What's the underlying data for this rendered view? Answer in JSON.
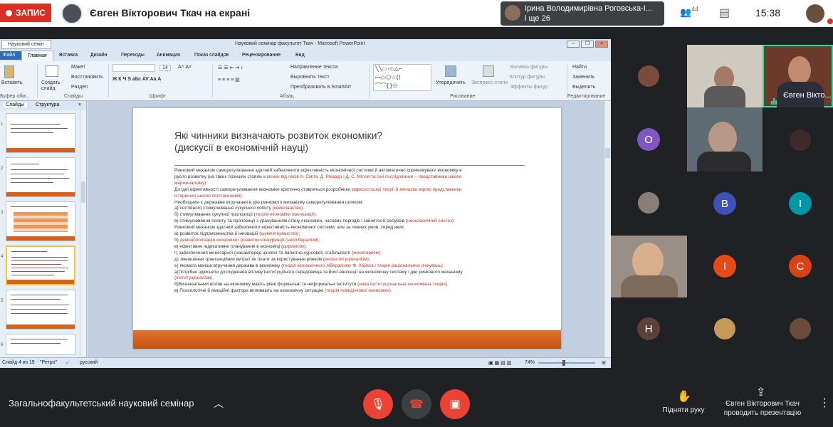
{
  "topbar": {
    "record_label": "ЗАПИС",
    "presenter_banner": "Євген Вікторович Ткач на екрані",
    "active_speaker_line1": "Ірина Володимирівна Роговська-І...",
    "active_speaker_line2": "і ще 26",
    "people_count": "44",
    "time": "15:38"
  },
  "ppt": {
    "tab_label": "Науковий семін",
    "window_title": "Науковий семінар факультет Ткач - Microsoft PowerPoint",
    "ribbon_tabs": [
      "Файл",
      "Главная",
      "Вставка",
      "Дизайн",
      "Переходы",
      "Анимация",
      "Показ слайдов",
      "Рецензирование",
      "Вид"
    ],
    "groups": {
      "clipboard": "Буфер обм...",
      "slides": "Слайды",
      "font": "Шрифт",
      "paragraph": "Абзац",
      "drawing": "Рисование",
      "editing": "Редактирование"
    },
    "ribbon": {
      "paste": "Вставить",
      "new_slide": "Создать слайд",
      "layout": "Макет",
      "reset": "Восстановить",
      "section": "Раздел",
      "font_size": "14",
      "text_direction": "Направление текста",
      "align_text": "Выровнять текст",
      "smartart": "Преобразовать в SmartArt",
      "arrange": "Упорядочить",
      "quick_styles": "Экспресс-стили",
      "shape_fill": "Заливка фигуры",
      "shape_outline": "Контур фигуры",
      "shape_effects": "Эффекты фигур",
      "find": "Найти",
      "replace": "Заменить",
      "select": "Выделить"
    },
    "panel_tabs": [
      "Слайды",
      "Структура"
    ],
    "thumb_numbers": [
      "1",
      "2",
      "3",
      "4",
      "5",
      "6"
    ],
    "slide": {
      "title_line1": "Які чинники визначають розвиток економіки?",
      "title_line2": "(дискусії в економічній науці)",
      "lines": [
        {
          "t": "Ринковий механізм саморегулювання здатний забезпечити ефективність економічної системи й автоматично спрямовувати економіку в",
          "r": ""
        },
        {
          "t": "русло розвитку (на таких позиціях стояли ",
          "r": "класики від часів А. Сміта, Д. Рікардо і Д. С. Мілля та їхні послідовники – представники школи"
        },
        {
          "t": "",
          "r": "маржиналізму)."
        },
        {
          "t": "До ідеї ефективності саморегулювання економіки критично ставляться розробники ",
          "r": "марксистської теорії й меншою мірою представники"
        },
        {
          "t": "",
          "r": "історичної школи політекономії)."
        },
        {
          "t": "Необхідним є державне втручання в дію ринкового механізму саморегулювання шляхом:",
          "r": ""
        },
        {
          "t": "а) постійного стимулювання сукупного попиту (",
          "r": "кейнсіанство);"
        },
        {
          "t": "б) стимулювання сукупної пропозиції (",
          "r": "теорія економіки пропозиції);"
        },
        {
          "t": "в) стимулювання попиту та пропозиції з урахуванням стану економіки, часових періодів і зайнятості ресурсів (",
          "r": "неокласичний синтез)."
        },
        {
          "t": " ",
          "r": ""
        },
        {
          "t": "Ринковий механізм здатний забезпечити ефективність економічної системи, але за певних умов, серед яких:",
          "r": ""
        },
        {
          "t": "а) розвиток підприємництва й інновацій (",
          "r": "шумпетеріанство);"
        },
        {
          "t": "б) ",
          "r": "демонополізація економіки і розвиток конкуренції (неолібералізм);"
        },
        {
          "t": "в) ефективне індикативне планування в економіці (",
          "r": "дирижизм);"
        },
        {
          "t": "г) забезпечення монетарної (насамперед цінової та валютно-курсової) стабільності (",
          "r": "монетаризм);"
        },
        {
          "t": "д) зменшення трансакційних витрат як плати за користування ринком (",
          "r": "неоінституціоналізм);"
        },
        {
          "t": "е) якомога менше втручання держави в економіку (",
          "r": "теорія економічного лібералізму Ф. Хайєка і теорія раціональних очікувань)."
        },
        {
          "t": " ",
          "r": ""
        },
        {
          "t": "а)Потрібно здійснити дослідження впливу інституційного середовища та його еволюції на економічну систему і дію ринкового механізму",
          "r": ""
        },
        {
          "t": "(",
          "r": "інституціоналізм)."
        },
        {
          "t": "б)Визначальний вплив на економіку мають рівні формальні та неформальні інститути (",
          "r": "нова інституціональна економічна теорія)."
        },
        {
          "t": "в) Психологічні й емоційні фактори впливають на економічну ситуацію (",
          "r": "теорія поведінкової економіки)."
        }
      ]
    },
    "status": {
      "slide_of": "Слайд 4 из 19",
      "theme": "\"Ретро\"",
      "lang": "русский",
      "zoom": "74%"
    }
  },
  "grid": {
    "featured_name": "Євген Вікто...",
    "letters": [
      "O",
      "B",
      "I",
      "I",
      "C",
      "H"
    ]
  },
  "bottom": {
    "meeting_title": "Загальнофакультетський науковий семінар",
    "raise_hand": "Підняти руку",
    "presenting_line1": "Євген Вікторович Ткач",
    "presenting_line2": "проводить презентацію"
  },
  "colors": {
    "record": "#d93025",
    "control_red": "#ea4335",
    "slide_accent": "#d6611c",
    "speaking": "#1ee1a8"
  }
}
